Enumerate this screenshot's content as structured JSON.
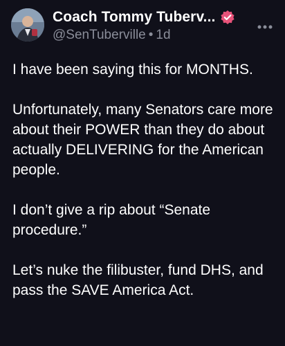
{
  "author": {
    "display_name": "Coach Tommy Tuberv...",
    "handle": "@SenTuberville",
    "time": "1d",
    "verified_color": "#e8537a"
  },
  "post": {
    "paragraphs": [
      "I have been saying this for MONTHS.",
      "Unfortunately, many Senators care more about their POWER than they do about actually DELIVERING for the American people.",
      "I don’t give a rip about “Senate procedure.”",
      "Let’s nuke the filibuster, fund DHS, and pass the SAVE America Act."
    ]
  },
  "icons": {
    "avatar": "profile-photo",
    "verified": "verified-badge-icon",
    "more": "more-options-icon"
  },
  "colors": {
    "background": "#10101a",
    "text": "#ffffff",
    "secondary_text": "#8a8d99"
  }
}
